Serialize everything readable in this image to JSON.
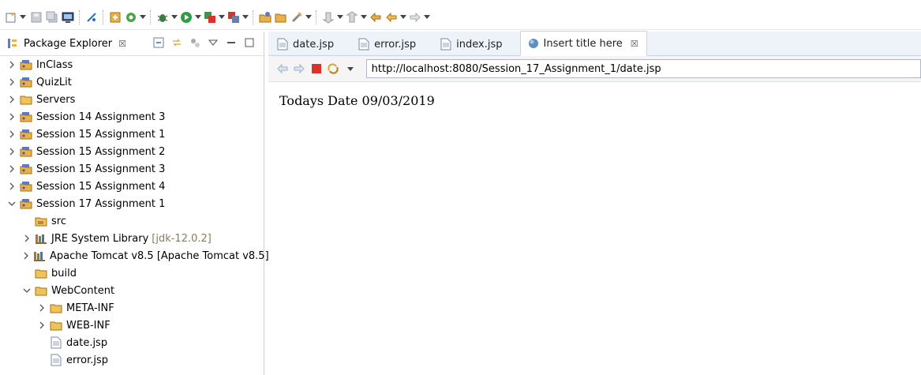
{
  "package_explorer": {
    "title": "Package Explorer",
    "close_symbol": "☒"
  },
  "tree": [
    {
      "label": "InClass",
      "indent": 0,
      "chevron": "right",
      "icon": "project"
    },
    {
      "label": "QuizLit",
      "indent": 0,
      "chevron": "right",
      "icon": "project"
    },
    {
      "label": "Servers",
      "indent": 0,
      "chevron": "right",
      "icon": "folder"
    },
    {
      "label": "Session 14 Assignment 3",
      "indent": 0,
      "chevron": "right",
      "icon": "project"
    },
    {
      "label": "Session 15 Assignment 1",
      "indent": 0,
      "chevron": "right",
      "icon": "project"
    },
    {
      "label": "Session 15 Assignment 2",
      "indent": 0,
      "chevron": "right",
      "icon": "project"
    },
    {
      "label": "Session 15 Assignment 3",
      "indent": 0,
      "chevron": "right",
      "icon": "project"
    },
    {
      "label": "Session 15 Assignment 4",
      "indent": 0,
      "chevron": "right",
      "icon": "project"
    },
    {
      "label": "Session 17 Assignment 1",
      "indent": 0,
      "chevron": "down",
      "icon": "project"
    },
    {
      "label": "src",
      "indent": 1,
      "chevron": "none",
      "icon": "src-folder"
    },
    {
      "label": "JRE System Library",
      "decoration": "[jdk-12.0.2]",
      "indent": 1,
      "chevron": "right",
      "icon": "library"
    },
    {
      "label": "Apache Tomcat v8.5 [Apache Tomcat v8.5]",
      "indent": 1,
      "chevron": "right",
      "icon": "library"
    },
    {
      "label": "build",
      "indent": 1,
      "chevron": "none",
      "icon": "folder"
    },
    {
      "label": "WebContent",
      "indent": 1,
      "chevron": "down",
      "icon": "folder"
    },
    {
      "label": "META-INF",
      "indent": 2,
      "chevron": "right",
      "icon": "folder"
    },
    {
      "label": "WEB-INF",
      "indent": 2,
      "chevron": "right",
      "icon": "folder"
    },
    {
      "label": "date.jsp",
      "indent": 2,
      "chevron": "none",
      "icon": "file"
    },
    {
      "label": "error.jsp",
      "indent": 2,
      "chevron": "none",
      "icon": "file"
    }
  ],
  "editor": {
    "tabs": [
      {
        "label": "date.jsp",
        "icon": "file",
        "active": false
      },
      {
        "label": "error.jsp",
        "icon": "file",
        "active": false
      },
      {
        "label": "index.jsp",
        "icon": "file",
        "active": false
      },
      {
        "label": "Insert title here",
        "icon": "globe",
        "active": true,
        "close": "☒"
      }
    ],
    "url": "http://localhost:8080/Session_17_Assignment_1/date.jsp",
    "page_text": "Todays Date 09/03/2019"
  },
  "colors": {
    "accent": "#2f6db5",
    "tab_bg": "#eef3fa",
    "folder": "#e8b24a",
    "stop_red": "#d9312b"
  }
}
